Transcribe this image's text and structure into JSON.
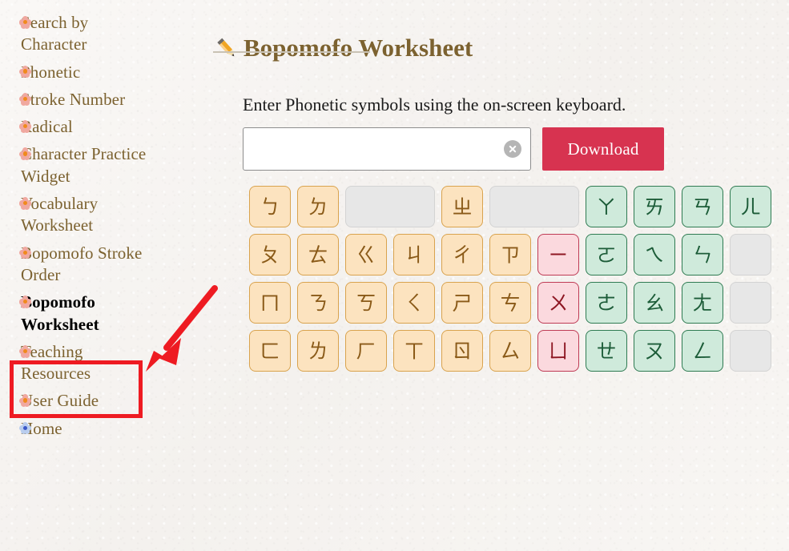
{
  "sidebar": {
    "items": [
      {
        "label": "Search by Character",
        "bullet": "pink-flower-icon",
        "active": false
      },
      {
        "label": "Phonetic",
        "bullet": "pink-flower-icon",
        "active": false
      },
      {
        "label": "Stroke Number",
        "bullet": "pink-flower-icon",
        "active": false
      },
      {
        "label": "Radical",
        "bullet": "pink-flower-icon",
        "active": false
      },
      {
        "label": "Character Practice Widget",
        "bullet": "pink-flower-icon",
        "active": false
      },
      {
        "label": "Vocabulary Worksheet",
        "bullet": "pink-flower-icon",
        "active": false
      },
      {
        "label": "Bopomofo Stroke Order",
        "bullet": "pink-flower-icon",
        "active": false
      },
      {
        "label": "Bopomofo Worksheet",
        "bullet": "pink-flower-icon",
        "active": true
      },
      {
        "label": "Teaching Resources",
        "bullet": "pink-flower-icon",
        "active": false
      },
      {
        "label": "User Guide",
        "bullet": "pink-flower-icon",
        "active": false
      },
      {
        "label": "Home",
        "bullet": "blue-flower-icon",
        "active": false
      }
    ]
  },
  "annotation": {
    "highlight_color": "#ee1b22",
    "arrow_color": "#ee1b22",
    "target": "Bopomofo Worksheet"
  },
  "main": {
    "title": "Bopomofo Worksheet",
    "title_icon": "pencil-icon",
    "instruction": "Enter Phonetic symbols using the on-screen keyboard.",
    "input": {
      "value": "",
      "placeholder": "",
      "clear_icon": "clear-circle-icon"
    },
    "download_label": "Download",
    "download_color": "#d73350"
  },
  "keyboard": {
    "colors": {
      "consonant_bg": "#fce3bf",
      "consonant_border": "#d9a34e",
      "medial_bg": "#fbd9de",
      "medial_border": "#bf3b55",
      "vowel_bg": "#cfeadb",
      "vowel_border": "#2f7b52",
      "blank_bg": "#e7e7e7"
    },
    "rows": [
      [
        {
          "symbol": "ㄅ",
          "type": "consonant"
        },
        {
          "symbol": "ㄉ",
          "type": "consonant"
        },
        {
          "symbol": "",
          "type": "blank",
          "wide": true
        },
        {
          "symbol": "ㄓ",
          "type": "consonant"
        },
        {
          "symbol": "",
          "type": "blank",
          "wide": true
        },
        {
          "symbol": "ㄚ",
          "type": "vowel"
        },
        {
          "symbol": "ㄞ",
          "type": "vowel"
        },
        {
          "symbol": "ㄢ",
          "type": "vowel"
        },
        {
          "symbol": "ㄦ",
          "type": "vowel"
        }
      ],
      [
        {
          "symbol": "ㄆ",
          "type": "consonant"
        },
        {
          "symbol": "ㄊ",
          "type": "consonant"
        },
        {
          "symbol": "ㄍ",
          "type": "consonant"
        },
        {
          "symbol": "ㄐ",
          "type": "consonant"
        },
        {
          "symbol": "ㄔ",
          "type": "consonant"
        },
        {
          "symbol": "ㄗ",
          "type": "consonant"
        },
        {
          "symbol": "ㄧ",
          "type": "medial"
        },
        {
          "symbol": "ㄛ",
          "type": "vowel"
        },
        {
          "symbol": "ㄟ",
          "type": "vowel"
        },
        {
          "symbol": "ㄣ",
          "type": "vowel"
        },
        {
          "symbol": "",
          "type": "blank"
        }
      ],
      [
        {
          "symbol": "ㄇ",
          "type": "consonant"
        },
        {
          "symbol": "ㄋ",
          "type": "consonant"
        },
        {
          "symbol": "ㄎ",
          "type": "consonant"
        },
        {
          "symbol": "ㄑ",
          "type": "consonant"
        },
        {
          "symbol": "ㄕ",
          "type": "consonant"
        },
        {
          "symbol": "ㄘ",
          "type": "consonant"
        },
        {
          "symbol": "ㄨ",
          "type": "medial"
        },
        {
          "symbol": "ㄜ",
          "type": "vowel"
        },
        {
          "symbol": "ㄠ",
          "type": "vowel"
        },
        {
          "symbol": "ㄤ",
          "type": "vowel"
        },
        {
          "symbol": "",
          "type": "blank"
        }
      ],
      [
        {
          "symbol": "ㄈ",
          "type": "consonant"
        },
        {
          "symbol": "ㄌ",
          "type": "consonant"
        },
        {
          "symbol": "ㄏ",
          "type": "consonant"
        },
        {
          "symbol": "ㄒ",
          "type": "consonant"
        },
        {
          "symbol": "ㄖ",
          "type": "consonant"
        },
        {
          "symbol": "ㄙ",
          "type": "consonant"
        },
        {
          "symbol": "ㄩ",
          "type": "medial"
        },
        {
          "symbol": "ㄝ",
          "type": "vowel"
        },
        {
          "symbol": "ㄡ",
          "type": "vowel"
        },
        {
          "symbol": "ㄥ",
          "type": "vowel"
        },
        {
          "symbol": "",
          "type": "blank"
        }
      ]
    ]
  }
}
